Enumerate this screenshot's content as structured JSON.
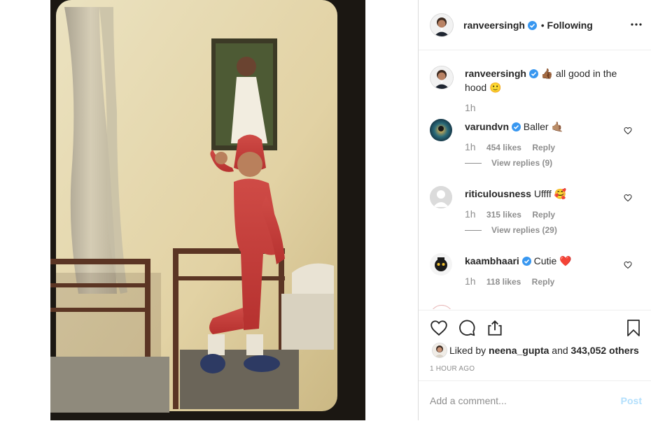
{
  "post": {
    "author": "ranveersingh",
    "follow_state": "Following",
    "separator": "•",
    "more_icon": "more-horizontal-icon"
  },
  "caption": {
    "user": "ranveersingh",
    "emoji_lead": "👍🏾",
    "text": "all good in the hood",
    "emoji_end": "🙂",
    "time": "1h"
  },
  "comments": [
    {
      "user": "varundvn",
      "verified": true,
      "text": "Baller",
      "emoji": "🤙🏽",
      "time": "1h",
      "likes": "454 likes",
      "reply": "Reply",
      "view_replies": "View replies (9)"
    },
    {
      "user": "riticulousness",
      "verified": false,
      "text": "Uffff",
      "emoji": "🥰",
      "time": "1h",
      "likes": "315 likes",
      "reply": "Reply",
      "view_replies": "View replies (29)"
    },
    {
      "user": "kaambhaari",
      "verified": true,
      "text": "Cutie",
      "emoji": "❤️",
      "time": "1h",
      "likes": "118 likes",
      "reply": "Reply"
    }
  ],
  "liked_by": {
    "prefix": "Liked by",
    "user": "neena_gupta",
    "middle": "and",
    "count": "343,052 others"
  },
  "timestamp": "1 HOUR AGO",
  "add_comment": {
    "placeholder": "Add a comment...",
    "post_label": "Post"
  },
  "colors": {
    "verified": "#3897f0",
    "link_disabled": "#b2dffc",
    "muted": "#8e8e8e"
  }
}
